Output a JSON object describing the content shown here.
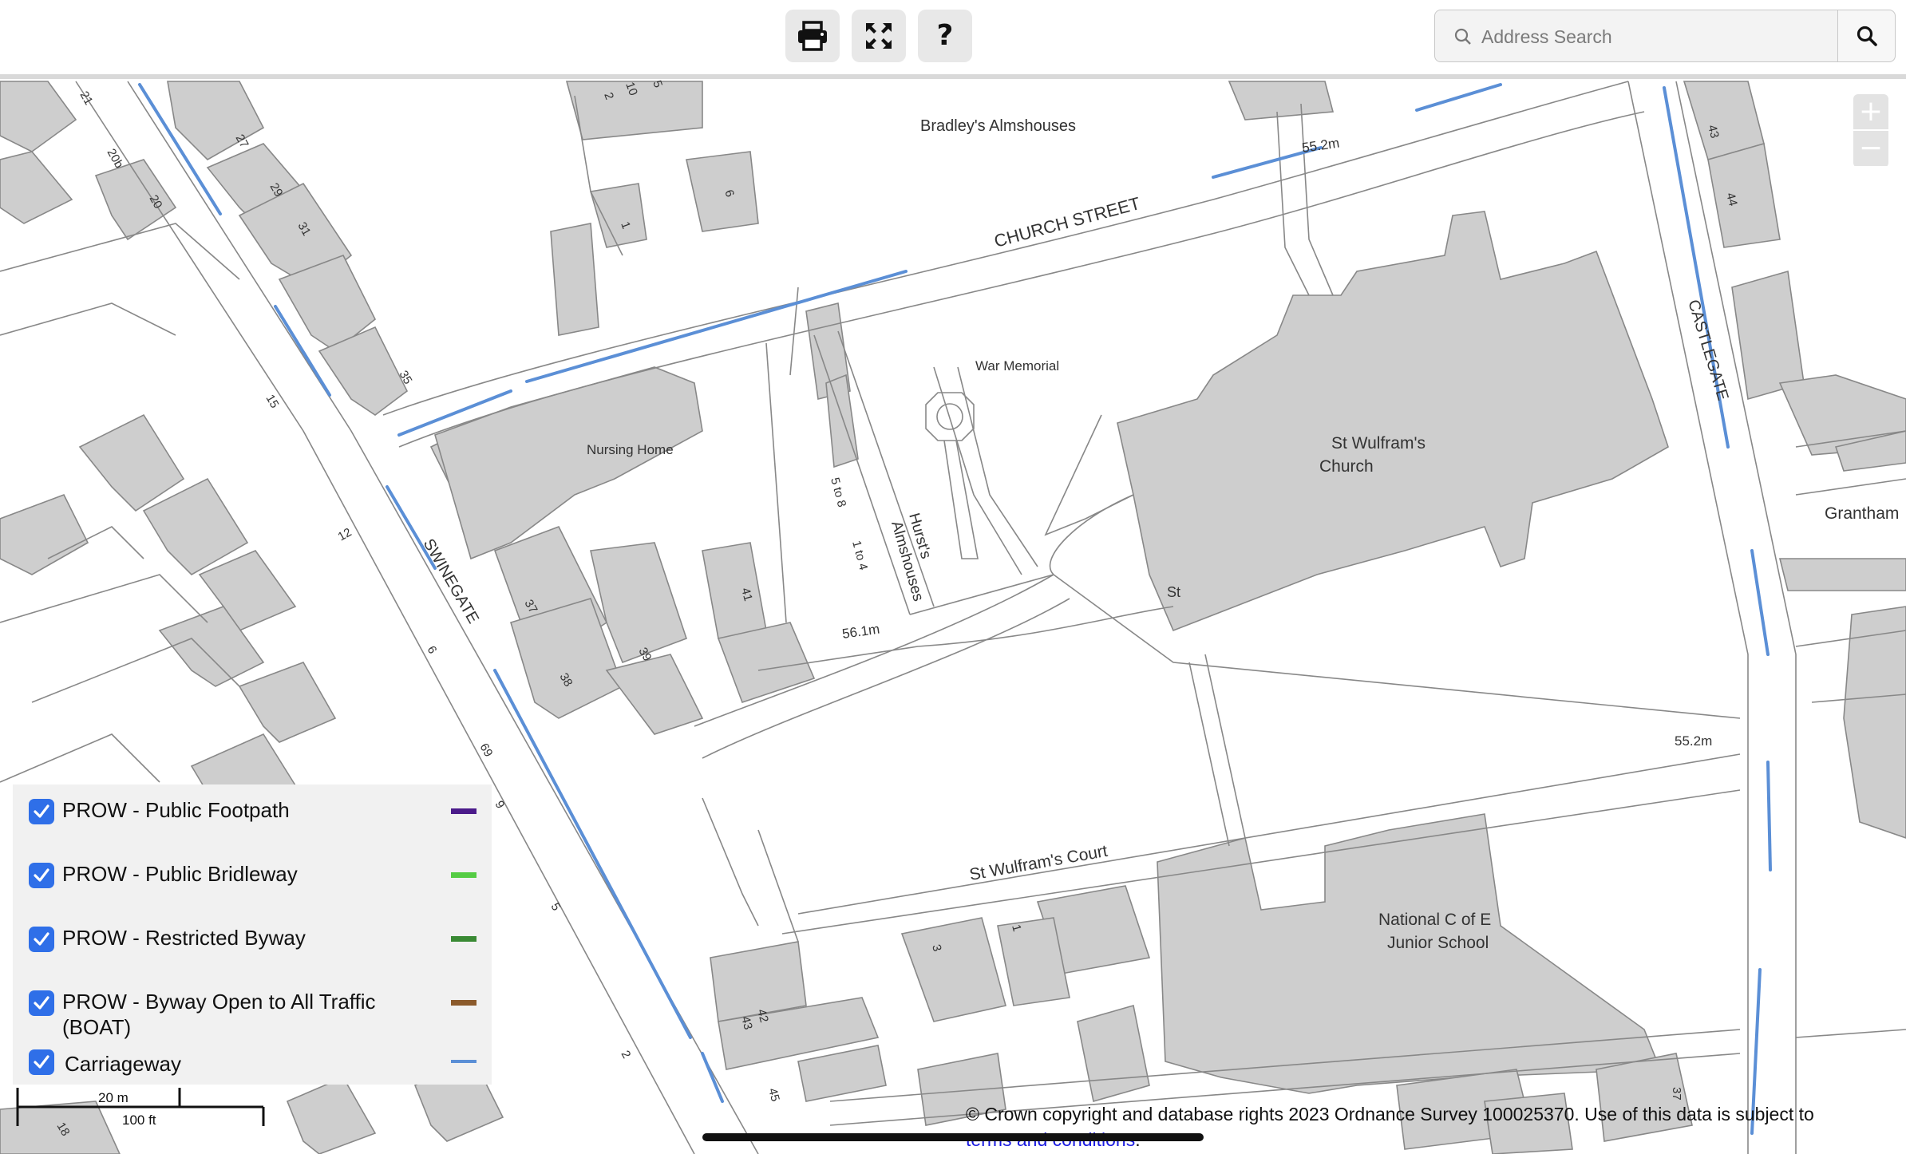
{
  "toolbar": {
    "print_icon": "print-icon",
    "fullscreen_icon": "expand-arrows-icon",
    "help_label": "?"
  },
  "search": {
    "placeholder": "Address Search",
    "button_icon": "search-icon"
  },
  "zoom": {
    "in_label": "+",
    "out_label": "−"
  },
  "colors": {
    "building": "#cecece",
    "outline": "#888888",
    "carriageway": "#5b8fd6",
    "footpath": "#4b1b8a",
    "bridleway": "#55cc44",
    "restricted_byway": "#3a8a34",
    "boat": "#8b5a2b"
  },
  "map_labels": {
    "bradleys": "Bradley's Almshouses",
    "church_street": "CHURCH STREET",
    "height_552_top": "55.2m",
    "war_memorial": "War Memorial",
    "nursing_home": "Nursing Home",
    "st_wulframs_1": "St Wulfram's",
    "st_wulframs_2": "Church",
    "castlegate": "CASTLEGATE",
    "swinegate": "SWINEGATE",
    "hursts_1": "Hurst's",
    "hursts_2": "Almshouses",
    "height_561": "56.1m",
    "height_552_right": "55.2m",
    "grantham": "Grantham",
    "st_wulframs_court": "St Wulfram's Court",
    "national_1": "National C of E",
    "national_2": "Junior School",
    "st_abbrev": "St",
    "n_21": "21",
    "n_27": "27",
    "n_29": "29",
    "n_31": "31",
    "n_20b": "20b",
    "n_20": "20",
    "n_35": "35",
    "n_15": "15",
    "n_12": "12",
    "n_37": "37",
    "n_38": "38",
    "n_39": "39",
    "n_41": "41",
    "n_5to8": "5 to 8",
    "n_1to4": "1 to 4",
    "n_2": "2",
    "n_10": "10",
    "n_5": "5",
    "n_6": "6",
    "n_1": "1",
    "n_43a": "43",
    "n_44": "44",
    "n_9": "9",
    "n_6b": "6",
    "n_69": "69",
    "n_5b": "5",
    "n_2b": "2",
    "n_3": "3",
    "n_1b": "1",
    "n_42": "42",
    "n_43b": "43",
    "n_45": "45",
    "n_18": "18",
    "n_37b": "37"
  },
  "legend": {
    "items": [
      {
        "label": "PROW - Public Footpath",
        "checked": true,
        "color": "#4b1b8a"
      },
      {
        "label": "PROW - Public Bridleway",
        "checked": true,
        "color": "#55cc44"
      },
      {
        "label": "PROW - Restricted Byway",
        "checked": true,
        "color": "#3a8a34"
      },
      {
        "label": "PROW - Byway Open to All Traffic (BOAT)",
        "checked": true,
        "color": "#8b5a2b"
      },
      {
        "label": "Carriageway",
        "checked": true,
        "color": "#5b8fd6"
      }
    ]
  },
  "scale": {
    "metric": "20 m",
    "imperial": "100 ft"
  },
  "attribution": {
    "text": "© Crown copyright and database rights 2023 Ordnance Survey 100025370. Use of this data is subject to",
    "link": "terms and conditions",
    "suffix": "."
  }
}
